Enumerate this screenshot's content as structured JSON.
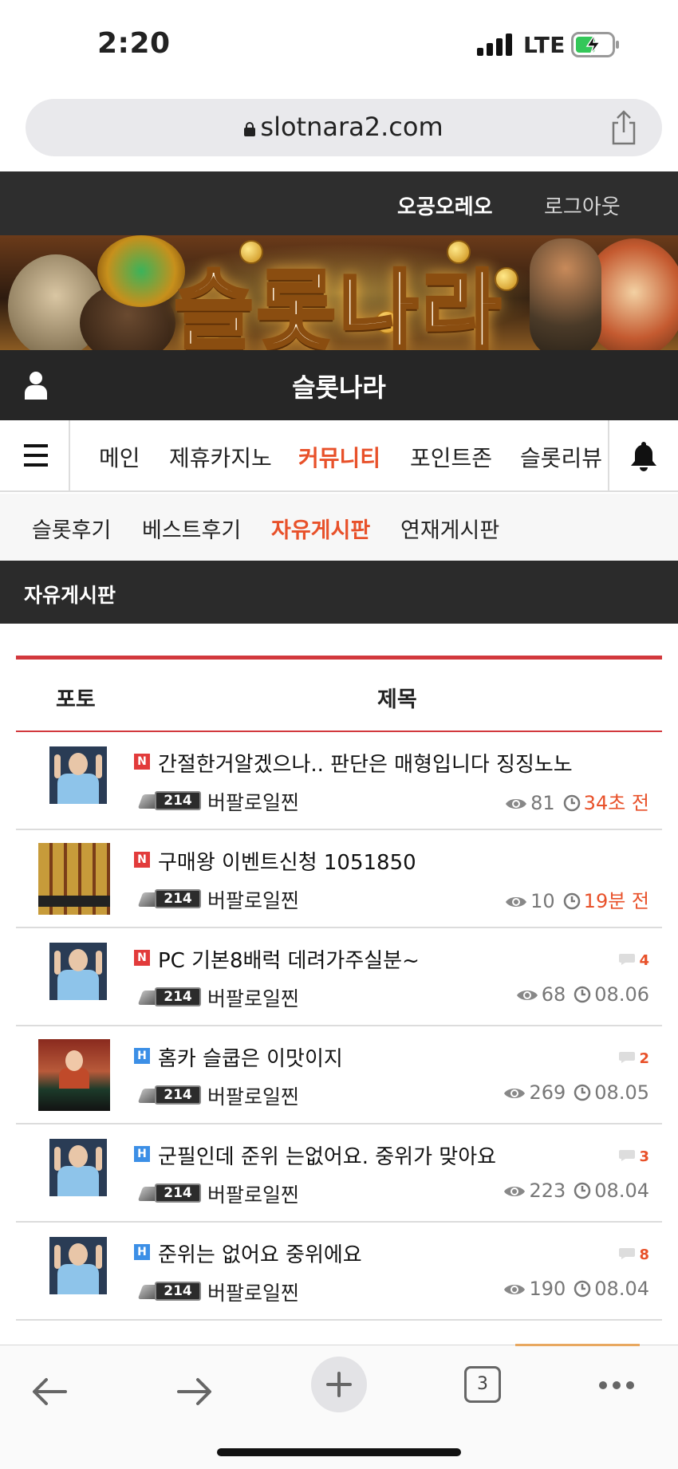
{
  "status_bar": {
    "time": "2:20",
    "network": "LTE"
  },
  "browser": {
    "url": "slotnara2.com",
    "tab_count": "3"
  },
  "header": {
    "username": "오공오레오",
    "logout": "로그아웃"
  },
  "banner": {
    "title": "슬롯나라"
  },
  "site_title": "슬롯나라",
  "main_nav": {
    "items": [
      "메인",
      "제휴카지노",
      "커뮤니티",
      "포인트존",
      "슬롯리뷰"
    ],
    "active": "커뮤니티"
  },
  "sub_nav": {
    "items": [
      "슬롯후기",
      "베스트후기",
      "자유게시판",
      "연재게시판"
    ],
    "active": "자유게시판"
  },
  "board_title": "자유게시판",
  "list": {
    "columns": {
      "photo": "포토",
      "title": "제목"
    },
    "rows": [
      {
        "badge": "N",
        "title": "간절한거알겠으나.. 판단은 매형입니다 징징노노",
        "comments": "",
        "level": "214",
        "author": "버팔로일찐",
        "views": "81",
        "time": "34초 전",
        "recent": true,
        "thumb": "person"
      },
      {
        "badge": "N",
        "title": "구매왕 이벤트신청 1051850",
        "comments": "",
        "level": "214",
        "author": "버팔로일찐",
        "views": "10",
        "time": "19분 전",
        "recent": true,
        "thumb": "game"
      },
      {
        "badge": "N",
        "title": "PC 기본8배럭 데려가주실분~",
        "comments": "4",
        "level": "214",
        "author": "버팔로일찐",
        "views": "68",
        "time": "08.06",
        "recent": false,
        "thumb": "person"
      },
      {
        "badge": "H",
        "title": "홈카 슬쿱은 이맛이지",
        "comments": "2",
        "level": "214",
        "author": "버팔로일찐",
        "views": "269",
        "time": "08.05",
        "recent": false,
        "thumb": "casino"
      },
      {
        "badge": "H",
        "title": "군필인데 준위 는없어요. 중위가 맞아요",
        "comments": "3",
        "level": "214",
        "author": "버팔로일찐",
        "views": "223",
        "time": "08.04",
        "recent": false,
        "thumb": "person"
      },
      {
        "badge": "H",
        "title": "준위는 없어요 중위에요",
        "comments": "8",
        "level": "214",
        "author": "버팔로일찐",
        "views": "190",
        "time": "08.04",
        "recent": false,
        "thumb": "person"
      }
    ]
  },
  "colors": {
    "accent": "#e8512a",
    "header_bg": "#2e2e2e",
    "list_border": "#d2383d",
    "badge_new": "#e23b3b",
    "badge_hot": "#3c8fe6"
  }
}
